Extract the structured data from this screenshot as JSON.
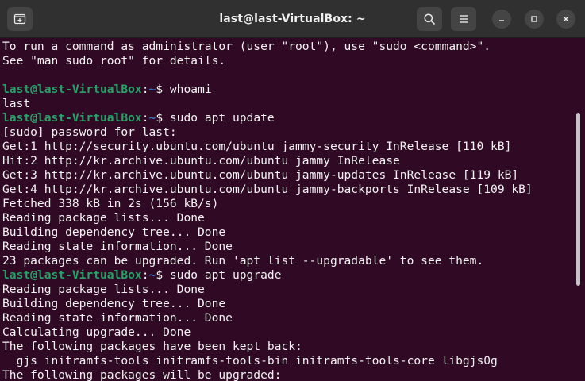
{
  "window": {
    "title": "last@last-VirtualBox: ~"
  },
  "icons": {
    "new_tab": "new-tab-icon",
    "search": "search-icon",
    "menu": "hamburger-menu-icon",
    "minimize": "minimize-icon",
    "maximize": "maximize-icon",
    "close": "close-icon"
  },
  "colors": {
    "background": "#300a24",
    "titlebar": "#303030",
    "prompt_user": "#26a269",
    "prompt_path": "#3a74c9",
    "text": "#f2f2f2"
  },
  "terminal": {
    "lines": [
      {
        "type": "output",
        "text": "To run a command as administrator (user \"root\"), use \"sudo <command>\"."
      },
      {
        "type": "output",
        "text": "See \"man sudo_root\" for details."
      },
      {
        "type": "output",
        "text": ""
      },
      {
        "type": "prompt",
        "user": "last@last-VirtualBox",
        "colon": ":",
        "path": "~",
        "cmd": "$ whoami"
      },
      {
        "type": "output",
        "text": "last"
      },
      {
        "type": "prompt",
        "user": "last@last-VirtualBox",
        "colon": ":",
        "path": "~",
        "cmd": "$ sudo apt update"
      },
      {
        "type": "output",
        "text": "[sudo] password for last:"
      },
      {
        "type": "output",
        "text": "Get:1 http://security.ubuntu.com/ubuntu jammy-security InRelease [110 kB]"
      },
      {
        "type": "output",
        "text": "Hit:2 http://kr.archive.ubuntu.com/ubuntu jammy InRelease"
      },
      {
        "type": "output",
        "text": "Get:3 http://kr.archive.ubuntu.com/ubuntu jammy-updates InRelease [119 kB]"
      },
      {
        "type": "output",
        "text": "Get:4 http://kr.archive.ubuntu.com/ubuntu jammy-backports InRelease [109 kB]"
      },
      {
        "type": "output",
        "text": "Fetched 338 kB in 2s (156 kB/s)"
      },
      {
        "type": "output",
        "text": "Reading package lists... Done"
      },
      {
        "type": "output",
        "text": "Building dependency tree... Done"
      },
      {
        "type": "output",
        "text": "Reading state information... Done"
      },
      {
        "type": "output",
        "text": "23 packages can be upgraded. Run 'apt list --upgradable' to see them."
      },
      {
        "type": "prompt",
        "user": "last@last-VirtualBox",
        "colon": ":",
        "path": "~",
        "cmd": "$ sudo apt upgrade"
      },
      {
        "type": "output",
        "text": "Reading package lists... Done"
      },
      {
        "type": "output",
        "text": "Building dependency tree... Done"
      },
      {
        "type": "output",
        "text": "Reading state information... Done"
      },
      {
        "type": "output",
        "text": "Calculating upgrade... Done"
      },
      {
        "type": "output",
        "text": "The following packages have been kept back:"
      },
      {
        "type": "output",
        "text": "  gjs initramfs-tools initramfs-tools-bin initramfs-tools-core libgjs0g"
      },
      {
        "type": "output",
        "text": "The following packages will be upgraded:"
      }
    ]
  }
}
